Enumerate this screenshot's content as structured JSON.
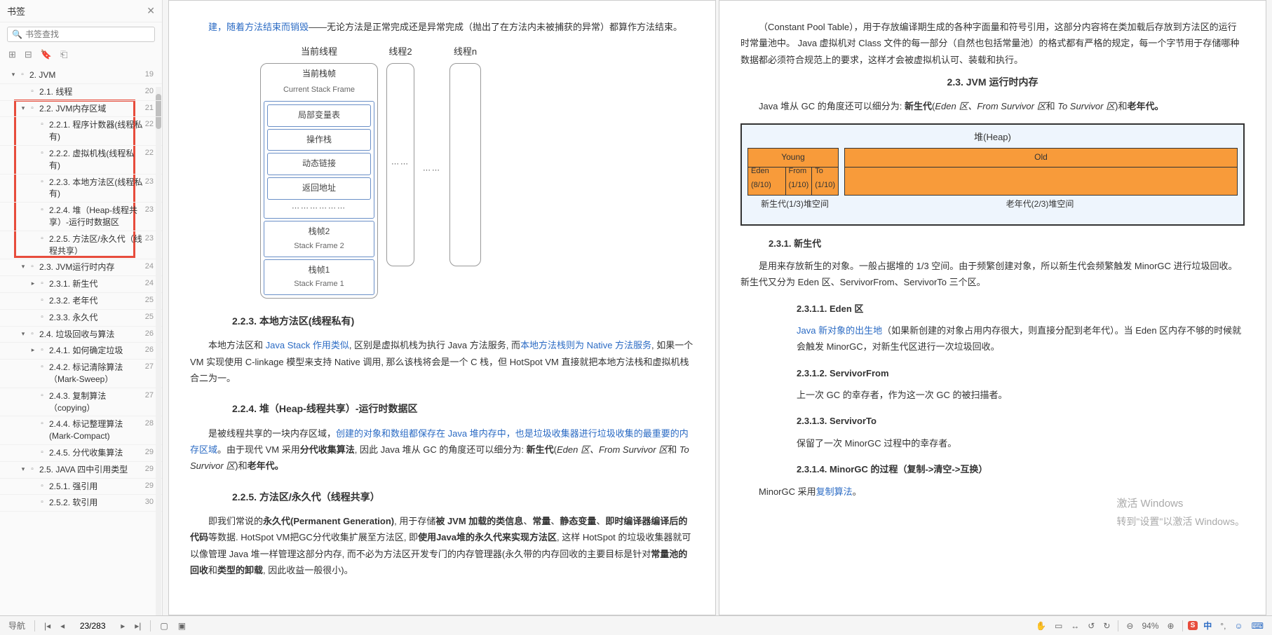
{
  "sidebar": {
    "title": "书签",
    "search_placeholder": "书签查找",
    "items": [
      {
        "label": "2. JVM",
        "page": "19",
        "level": 0,
        "chevron": "▾",
        "icon": "▫"
      },
      {
        "label": "2.1. 线程",
        "page": "20",
        "level": 1,
        "chevron": "",
        "icon": "▫"
      },
      {
        "label": "2.2. JVM内存区域",
        "page": "21",
        "level": 1,
        "chevron": "▾",
        "icon": "▫"
      },
      {
        "label": "2.2.1. 程序计数器(线程私有)",
        "page": "22",
        "level": 2,
        "chevron": "",
        "icon": "▫"
      },
      {
        "label": "2.2.2. 虚拟机栈(线程私有)",
        "page": "22",
        "level": 2,
        "chevron": "",
        "icon": "▫"
      },
      {
        "label": "2.2.3. 本地方法区(线程私有)",
        "page": "23",
        "level": 2,
        "chevron": "",
        "icon": "▫"
      },
      {
        "label": "2.2.4. 堆（Heap-线程共享）-运行时数据区",
        "page": "23",
        "level": 2,
        "chevron": "",
        "icon": "▫"
      },
      {
        "label": "2.2.5. 方法区/永久代（线程共享）",
        "page": "23",
        "level": 2,
        "chevron": "",
        "icon": "▫"
      },
      {
        "label": "2.3. JVM运行时内存",
        "page": "24",
        "level": 1,
        "chevron": "▾",
        "icon": "▫"
      },
      {
        "label": "2.3.1. 新生代",
        "page": "24",
        "level": 2,
        "chevron": "▸",
        "icon": "▫"
      },
      {
        "label": "2.3.2. 老年代",
        "page": "25",
        "level": 2,
        "chevron": "",
        "icon": "▫"
      },
      {
        "label": "2.3.3. 永久代",
        "page": "25",
        "level": 2,
        "chevron": "",
        "icon": "▫"
      },
      {
        "label": "2.4. 垃圾回收与算法",
        "page": "26",
        "level": 1,
        "chevron": "▾",
        "icon": "▫"
      },
      {
        "label": "2.4.1. 如何确定垃圾",
        "page": "26",
        "level": 2,
        "chevron": "▸",
        "icon": "▫"
      },
      {
        "label": "2.4.2. 标记清除算法（Mark-Sweep）",
        "page": "27",
        "level": 2,
        "chevron": "",
        "icon": "▫"
      },
      {
        "label": "2.4.3. 复制算法（copying）",
        "page": "27",
        "level": 2,
        "chevron": "",
        "icon": "▫"
      },
      {
        "label": "2.4.4. 标记整理算法(Mark-Compact)",
        "page": "28",
        "level": 2,
        "chevron": "",
        "icon": "▫"
      },
      {
        "label": "2.4.5. 分代收集算法",
        "page": "29",
        "level": 2,
        "chevron": "",
        "icon": "▫"
      },
      {
        "label": "2.5. JAVA 四中引用类型",
        "page": "29",
        "level": 1,
        "chevron": "▾",
        "icon": "▫"
      },
      {
        "label": "2.5.1. 强引用",
        "page": "29",
        "level": 2,
        "chevron": "",
        "icon": "▫"
      },
      {
        "label": "2.5.2. 软引用",
        "page": "30",
        "level": 2,
        "chevron": "",
        "icon": "▫"
      }
    ]
  },
  "left_page": {
    "intro_link": "建，随着方法结束而销毁",
    "intro_rest": "——无论方法是正常完成还是异常完成（抛出了在方法内未被捕获的异常）都算作方法结束。",
    "stack": {
      "col1_label": "当前线程",
      "col2_label": "线程2",
      "col3_label": "线程n",
      "dots_mid": "⋯⋯",
      "header": "当前栈帧",
      "header_sub": "Current Stack Frame",
      "cells": [
        "局部变量表",
        "操作栈",
        "动态链接",
        "返回地址"
      ],
      "ellipsis": "⋯⋯⋯⋯⋯⋯",
      "frame2": "栈帧2",
      "frame2_sub": "Stack Frame 2",
      "frame1": "栈帧1",
      "frame1_sub": "Stack Frame 1"
    },
    "h223": "2.2.3.  本地方法区(线程私有)",
    "p223_a": "本地方法区和 ",
    "p223_link1": "Java Stack 作用类似",
    "p223_b": ", 区别是虚拟机栈为执行 Java 方法服务, 而",
    "p223_link2": "本地方法栈则为 Native 方法服务",
    "p223_c": ", 如果一个 VM 实现使用 C-linkage 模型来支持 Native 调用, 那么该栈将会是一个 C 栈，但 HotSpot VM 直接就把本地方法栈和虚拟机栈合二为一。",
    "h224": "2.2.4.  堆（Heap-线程共享）-运行时数据区",
    "p224_a": "是被线程共享的一块内存区域，",
    "p224_link": "创建的对象和数组都保存在 Java 堆内存中，也是垃圾收集器进行垃圾收集的最重要的内存区域",
    "p224_b": "。由于现代 VM 采用",
    "p224_bold1": "分代收集算法",
    "p224_c": ", 因此 Java 堆从 GC 的角度还可以细分为: ",
    "p224_bold2": "新生代",
    "p224_d": "(",
    "p224_italic": "Eden 区、From Survivor 区",
    "p224_e": "和 ",
    "p224_italic2": "To Survivor 区",
    "p224_f": ")和",
    "p224_bold3": "老年代。",
    "h225": "2.2.5.  方法区/永久代（线程共享）",
    "p225_a": "即我们常说的",
    "p225_b1": "永久代(Permanent Generation)",
    "p225_b": ", 用于存储",
    "p225_b2": "被 JVM 加载的类信息",
    "p225_c": "、",
    "p225_b3": "常量",
    "p225_d": "、",
    "p225_b4": "静态变量",
    "p225_e": "、",
    "p225_b5": "即时编译器编译后的代码",
    "p225_f": "等数据. HotSpot VM把GC分代收集扩展至方法区, 即",
    "p225_b6": "使用Java堆的永久代来实现方法区",
    "p225_g": ", 这样 HotSpot 的垃圾收集器就可以像管理 Java 堆一样管理这部分内存, 而不必为方法区开发专门的内存管理器(永久带的内存回收的主要目标是针对",
    "p225_b7": "常量池的回收",
    "p225_h": "和",
    "p225_b8": "类型的卸载",
    "p225_i": ", 因此收益一般很小)。"
  },
  "right_page": {
    "header_a": "（Constant Pool Table），用于存放编译期生成的各种字面量和符号引用，这部分内容将在类加载后存放到方法区的运行时常量池中。 Java 虚拟机对 Class 文件的每一部分（自然也包括常量池）的格式都有严格的规定，每一个字节用于存储哪种数据都必须符合规范上的要求，这样才会被虚拟机认可、装载和执行。",
    "h23": "2.3. JVM 运行时内存",
    "p23_a": "Java 堆从 GC 的角度还可以细分为: ",
    "p23_b1": "新生代",
    "p23_b": "(",
    "p23_i1": "Eden 区、From Survivor 区",
    "p23_c": "和 ",
    "p23_i2": "To Survivor 区",
    "p23_d": ")和",
    "p23_b2": "老年代。",
    "heap": {
      "title": "堆(Heap)",
      "young": "Young",
      "old": "Old",
      "eden": "Eden",
      "eden_r": "(8/10)",
      "from": "From",
      "from_r": "(1/10)",
      "to": "To",
      "to_r": "(1/10)",
      "label_l": "新生代(1/3)堆空间",
      "label_r": "老年代(2/3)堆空间"
    },
    "h231": "2.3.1.  新生代",
    "p231": "是用来存放新生的对象。一般占据堆的 1/3 空间。由于频繁创建对象，所以新生代会频繁触发 MinorGC 进行垃圾回收。新生代又分为 Eden 区、ServivorFrom、ServivorTo 三个区。",
    "h2311": "2.3.1.1.    Eden 区",
    "p2311_link": "Java 新对象的出生地",
    "p2311": "（如果新创建的对象占用内存很大，则直接分配到老年代）。当 Eden 区内存不够的时候就会触发 MinorGC，对新生代区进行一次垃圾回收。",
    "h2312": "2.3.1.2.    ServivorFrom",
    "p2312": "上一次 GC 的幸存者，作为这一次 GC 的被扫描者。",
    "h2313": "2.3.1.3.    ServivorTo",
    "p2313": "保留了一次 MinorGC 过程中的幸存者。",
    "h2314": "2.3.1.4.    MinorGC 的过程（复制->清空->互换）",
    "p2314_a": "MinorGC 采用",
    "p2314_link": "复制算法",
    "p2314_b": "。"
  },
  "footer": {
    "nav_label": "导航",
    "page_display": "23/283",
    "zoom": "94%",
    "ime": "中"
  },
  "watermark": {
    "line1": "激活 Windows",
    "line2": "转到\"设置\"以激活 Windows。"
  }
}
